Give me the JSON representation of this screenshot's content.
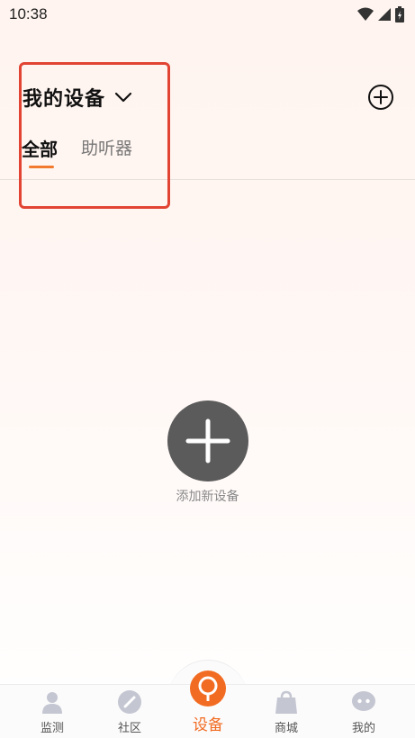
{
  "status_bar": {
    "time": "10:38"
  },
  "header": {
    "title": "我的设备",
    "tabs": [
      {
        "label": "全部",
        "active": true
      },
      {
        "label": "助听器",
        "active": false
      }
    ]
  },
  "empty_state": {
    "label": "添加新设备"
  },
  "bottom_nav": {
    "items": [
      {
        "label": "监测",
        "icon": "person-icon"
      },
      {
        "label": "社区",
        "icon": "slash-circle-icon"
      },
      {
        "label": "设备",
        "icon": "device-pin-icon",
        "active": true
      },
      {
        "label": "商城",
        "icon": "shopping-bag-icon"
      },
      {
        "label": "我的",
        "icon": "chat-bubble-icon"
      }
    ]
  },
  "colors": {
    "accent": "#f26b22",
    "tab_indicator": "#f27a2e",
    "highlight": "#e24433",
    "add_circle": "#5b5b5b"
  }
}
